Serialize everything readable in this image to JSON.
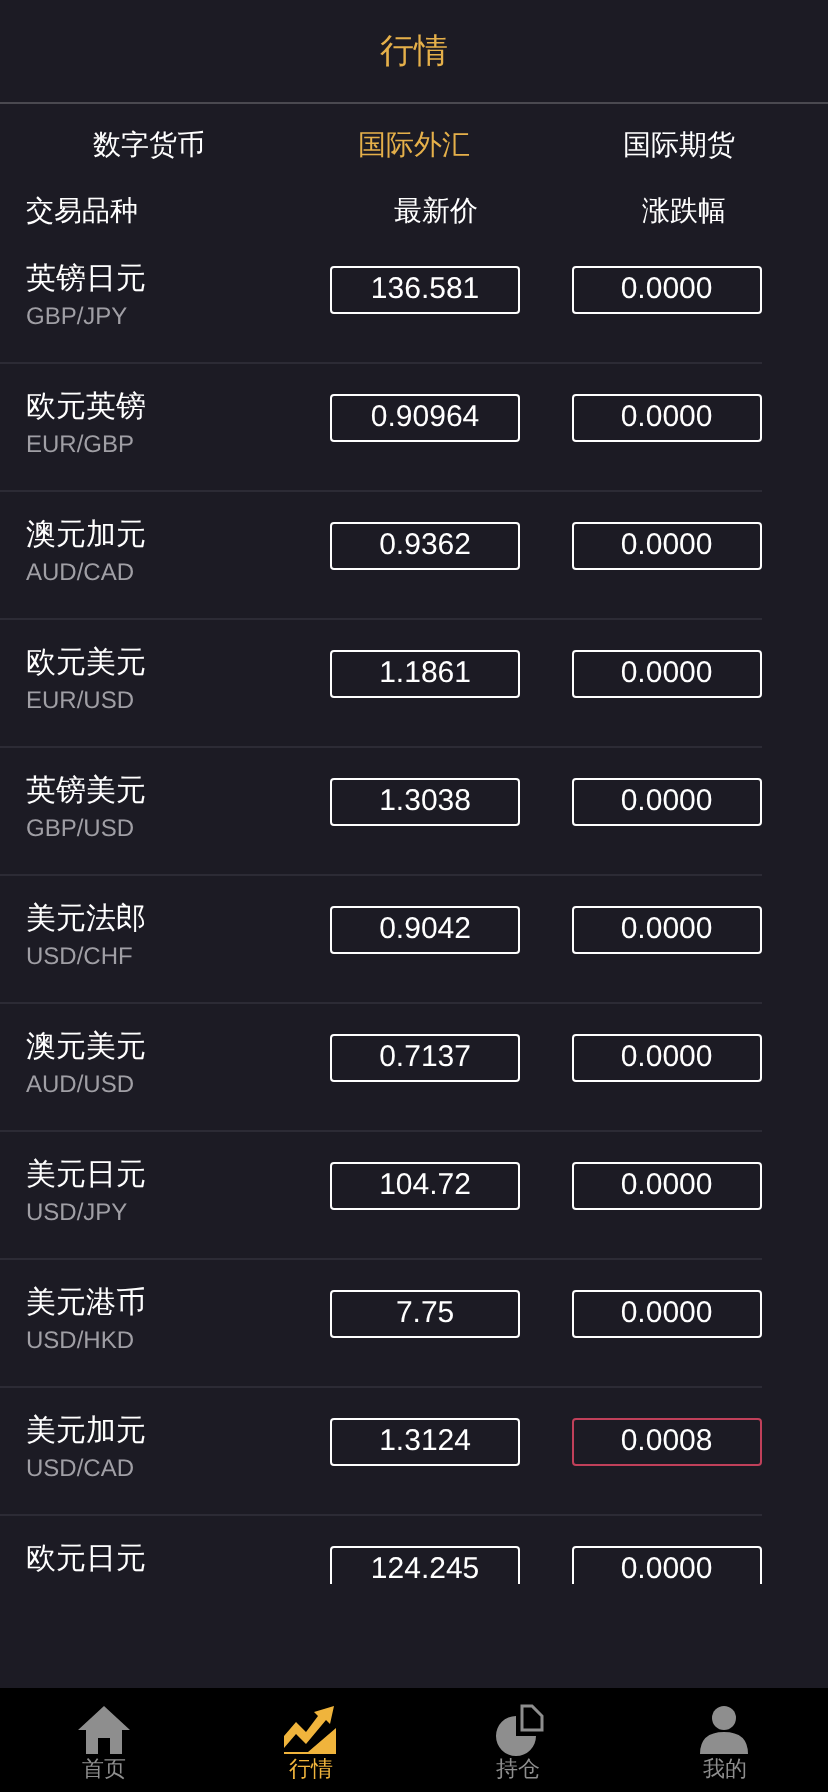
{
  "header": {
    "title": "行情"
  },
  "tabs": [
    {
      "label": "数字货币",
      "selected": false
    },
    {
      "label": "国际外汇",
      "selected": true
    },
    {
      "label": "国际期货",
      "selected": false
    }
  ],
  "columns": [
    "交易品种",
    "最新价",
    "涨跌幅"
  ],
  "rows": [
    {
      "name": "英镑日元",
      "code": "GBP/JPY",
      "price": "136.581",
      "change": "0.0000",
      "rising": false
    },
    {
      "name": "欧元英镑",
      "code": "EUR/GBP",
      "price": "0.90964",
      "change": "0.0000",
      "rising": false
    },
    {
      "name": "澳元加元",
      "code": "AUD/CAD",
      "price": "0.9362",
      "change": "0.0000",
      "rising": false
    },
    {
      "name": "欧元美元",
      "code": "EUR/USD",
      "price": "1.1861",
      "change": "0.0000",
      "rising": false
    },
    {
      "name": "英镑美元",
      "code": "GBP/USD",
      "price": "1.3038",
      "change": "0.0000",
      "rising": false
    },
    {
      "name": "美元法郎",
      "code": "USD/CHF",
      "price": "0.9042",
      "change": "0.0000",
      "rising": false
    },
    {
      "name": "澳元美元",
      "code": "AUD/USD",
      "price": "0.7137",
      "change": "0.0000",
      "rising": false
    },
    {
      "name": "美元日元",
      "code": "USD/JPY",
      "price": "104.72",
      "change": "0.0000",
      "rising": false
    },
    {
      "name": "美元港币",
      "code": "USD/HKD",
      "price": "7.75",
      "change": "0.0000",
      "rising": false
    },
    {
      "name": "美元加元",
      "code": "USD/CAD",
      "price": "1.3124",
      "change": "0.0008",
      "rising": true
    },
    {
      "name": "欧元日元",
      "price": "124.245",
      "change": "0.0000",
      "rising": false
    }
  ],
  "bottom_nav": [
    {
      "label": "首页",
      "kind": "home",
      "selected": false
    },
    {
      "label": "行情",
      "kind": "market",
      "selected": true
    },
    {
      "label": "持仓",
      "kind": "positions",
      "selected": false
    },
    {
      "label": "我的",
      "kind": "profile",
      "selected": false
    }
  ]
}
